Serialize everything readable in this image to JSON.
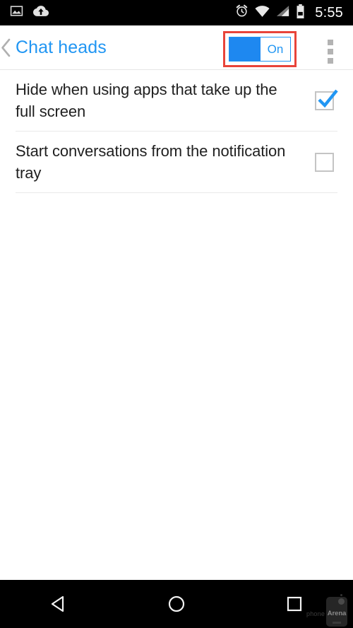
{
  "status_bar": {
    "left_icons": [
      {
        "name": "image-icon",
        "label": "Screenshot"
      },
      {
        "name": "cloud-upload-icon",
        "label": "Backup upload"
      }
    ],
    "right_icons": [
      {
        "name": "alarm-clock-icon",
        "label": "Alarm set"
      },
      {
        "name": "wifi-icon",
        "label": "Wi-Fi"
      },
      {
        "name": "cellular-signal-icon",
        "label": "Mobile signal"
      },
      {
        "name": "battery-icon",
        "label": "Battery"
      }
    ],
    "time": "5:55"
  },
  "header": {
    "back_label": "‹",
    "title": "Chat heads",
    "overflow_label": "More options",
    "toggle": {
      "state_label": "On",
      "is_on": true,
      "highlight_color": "#e8443a",
      "accent_color": "#2196f3"
    }
  },
  "settings": {
    "items": [
      {
        "label": "Hide when using apps that take up the full screen",
        "checked": true,
        "checkbox_name": "checkbox-hide-fullscreen"
      },
      {
        "label": "Start conversations from the notification tray",
        "checked": false,
        "checkbox_name": "checkbox-start-from-tray"
      }
    ]
  },
  "nav_bar": {
    "buttons": [
      {
        "name": "nav-back-button",
        "label": "Back"
      },
      {
        "name": "nav-home-button",
        "label": "Home"
      },
      {
        "name": "nav-recents-button",
        "label": "Recent apps"
      }
    ],
    "watermark": {
      "text_primary": "phone",
      "text_secondary": "Arena"
    }
  },
  "colors": {
    "accent_blue": "#2196f3",
    "toggle_fill": "#1e88f0",
    "annotation_red": "#e8443a",
    "text_primary": "#1f1f1f",
    "divider": "#e9e9e9",
    "status_bar_bg": "#000000"
  }
}
